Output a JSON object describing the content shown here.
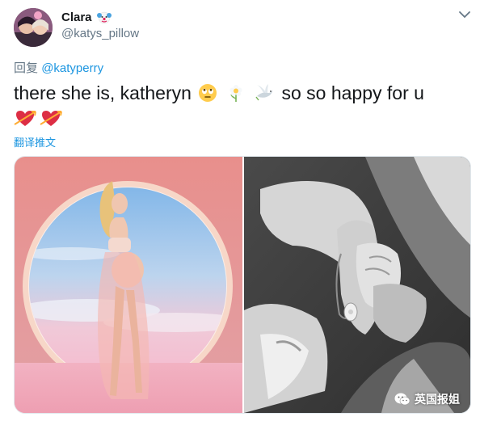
{
  "user": {
    "display_name": "Clara",
    "name_emoji": "clown-face-emoji",
    "handle": "@katys_pillow"
  },
  "reply": {
    "prefix": "回复",
    "mention": "@katyperry"
  },
  "tweet": {
    "text": "there she is, katheryn",
    "text_end": "so so happy for u",
    "emojis_line1": [
      "rolling-eyes-face-emoji",
      "blossom-emoji",
      "dove-emoji"
    ],
    "emojis_line2": [
      "heart-with-arrow-emoji",
      "heart-with-arrow-emoji"
    ]
  },
  "translate_label": "翻译推文",
  "media": {
    "photos": [
      "pregnant-woman-in-sheer-dress-photo",
      "baby-hand-holding-adult-finger-photo"
    ]
  },
  "watermark": {
    "text": "英国报姐",
    "icon": "wechat-icon"
  },
  "colors": {
    "link": "#1b95e0",
    "secondary_text": "#657786",
    "primary_text": "#14171a"
  }
}
